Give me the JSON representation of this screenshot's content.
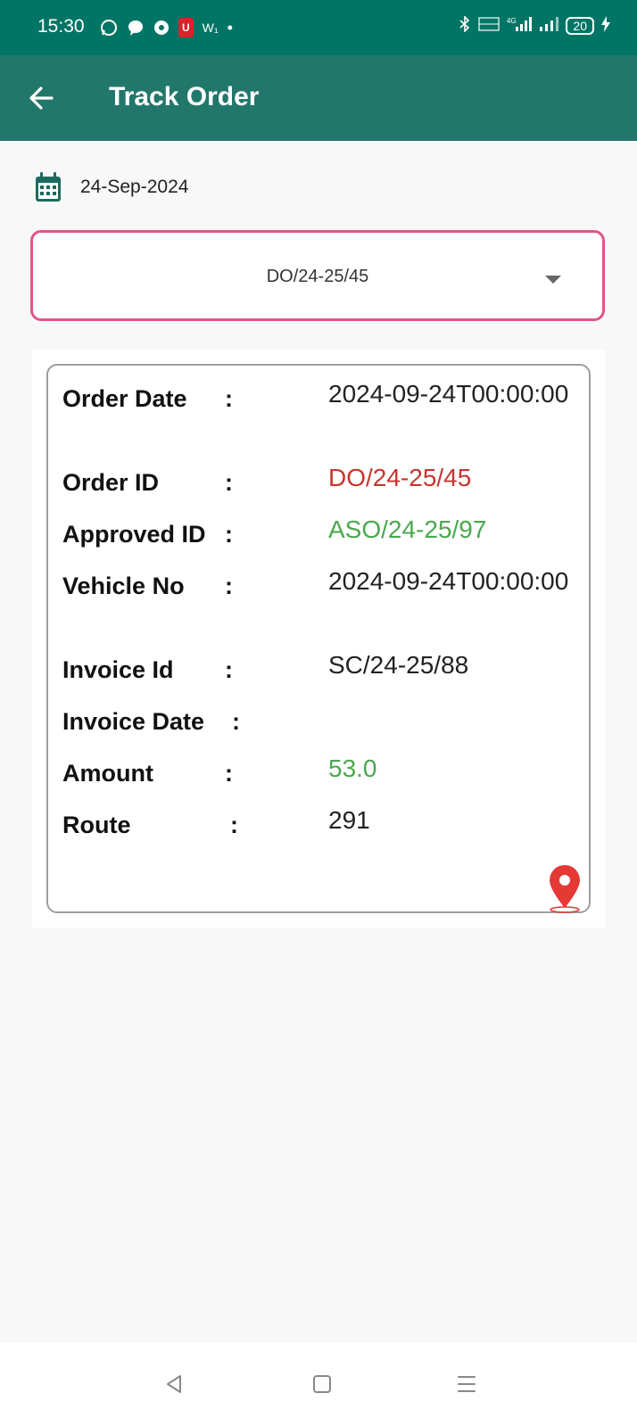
{
  "status_bar": {
    "time": "15:30",
    "left_icons": [
      "whatsapp-icon",
      "message-icon",
      "chrome-icon",
      "app-badge-icon",
      "w-app-icon",
      "dot-icon"
    ],
    "badge_text": "U",
    "w_text": "W₁",
    "battery": "20"
  },
  "app_bar": {
    "title": "Track Order"
  },
  "date": {
    "value": "24-Sep-2024"
  },
  "order_select": {
    "selected": "DO/24-25/45"
  },
  "details": {
    "order_date_label": "Order Date",
    "order_date_value": "2024-09-24T00:00:00",
    "order_id_label": "Order ID",
    "order_id_value": "DO/24-25/45",
    "approved_id_label": "Approved ID",
    "approved_id_value": "ASO/24-25/97",
    "vehicle_no_label": "Vehicle No",
    "vehicle_no_value": "2024-09-24T00:00:00",
    "invoice_id_label": "Invoice Id",
    "invoice_id_value": "SC/24-25/88",
    "invoice_date_label": "Invoice Date",
    "invoice_date_value": "",
    "amount_label": "Amount",
    "amount_value": "53.0",
    "route_label": "Route",
    "route_value": "291",
    "colon": ":"
  },
  "colors": {
    "status_bar": "#007565",
    "app_bar": "#22776b",
    "dropdown_border": "#e0558a",
    "order_id": "#c6362e",
    "positive": "#4aa84e",
    "pin": "#e53935"
  }
}
